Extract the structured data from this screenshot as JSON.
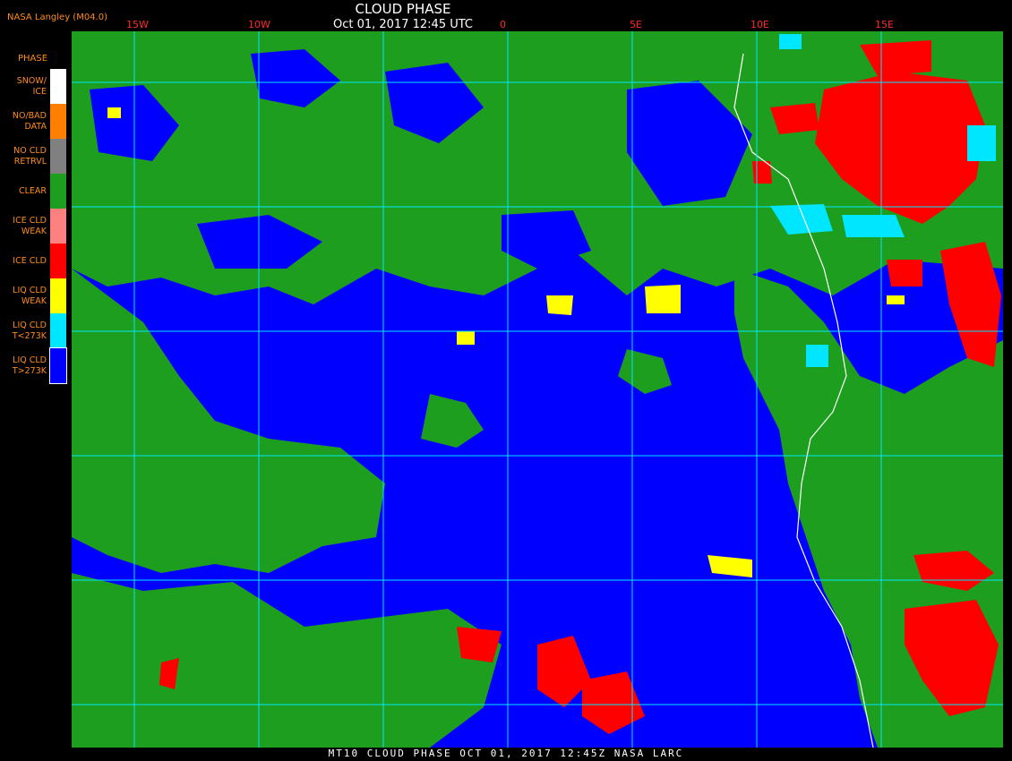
{
  "header": {
    "source": "NASA Langley (M04.0)",
    "title": "CLOUD PHASE",
    "datetime": "Oct 01, 2017 12:45 UTC"
  },
  "map": {
    "longitude_labels": [
      "15W",
      "10W",
      "0",
      "5E",
      "10E",
      "15E"
    ],
    "colors": {
      "snow_ice": "#ffffff",
      "no_bad_data": "#ff8000",
      "no_cld_retrvl": "#808080",
      "clear": "#1e9e1e",
      "ice_cld_weak": "#ff8080",
      "ice_cld": "#ff0000",
      "liq_cld_weak": "#ffff00",
      "liq_cld_cold": "#00e6ff",
      "liq_cld_warm": "#0000ff",
      "gridline": "#00e6ff",
      "coastline": "#ffffff"
    }
  },
  "legend": {
    "title": "PHASE",
    "items": [
      {
        "label": "SNOW/\nICE",
        "color": "#ffffff"
      },
      {
        "label": "NO/BAD\nDATA",
        "color": "#ff8000"
      },
      {
        "label": "NO CLD\nRETRVL",
        "color": "#808080"
      },
      {
        "label": "CLEAR",
        "color": "#1e9e1e"
      },
      {
        "label": "ICE CLD\nWEAK",
        "color": "#ff8080"
      },
      {
        "label": "ICE CLD",
        "color": "#ff0000"
      },
      {
        "label": "LIQ CLD\nWEAK",
        "color": "#ffff00"
      },
      {
        "label": "LIQ CLD\nT<273K",
        "color": "#00e6ff"
      },
      {
        "label": "LIQ CLD\nT>273K",
        "color": "#0000ff"
      }
    ]
  },
  "footer": {
    "text": "MT10  CLOUD PHASE   OCT 01, 2017 12:45Z   NASA LARC"
  }
}
